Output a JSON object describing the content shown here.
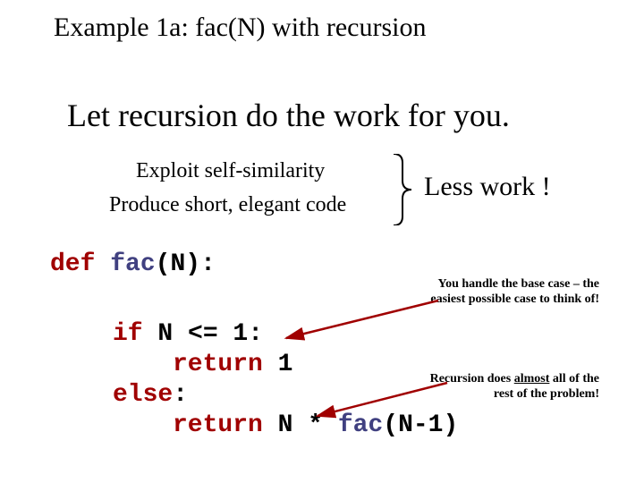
{
  "title": "Example 1a: fac(N) with recursion",
  "headline": "Let recursion do the work for you.",
  "sub1": "Exploit self-similarity",
  "sub2": "Produce short, elegant code",
  "right_label": "Less work !",
  "code": {
    "def_kw": "def",
    "func": "fac",
    "sig_rest": "(N):",
    "if_kw": "if",
    "if_cond": " N <= 1:",
    "return_kw": "return",
    "ret1_rest": " 1",
    "else_kw": "else",
    "else_rest": ":",
    "ret2_rest_a": " N * ",
    "ret2_rest_b": "(N-1)"
  },
  "note1_a": "You handle the base case – the easiest possible case to think of!",
  "note2_a": "Recursion does ",
  "note2_b": "almost",
  "note2_c": " all of the rest of the problem!"
}
